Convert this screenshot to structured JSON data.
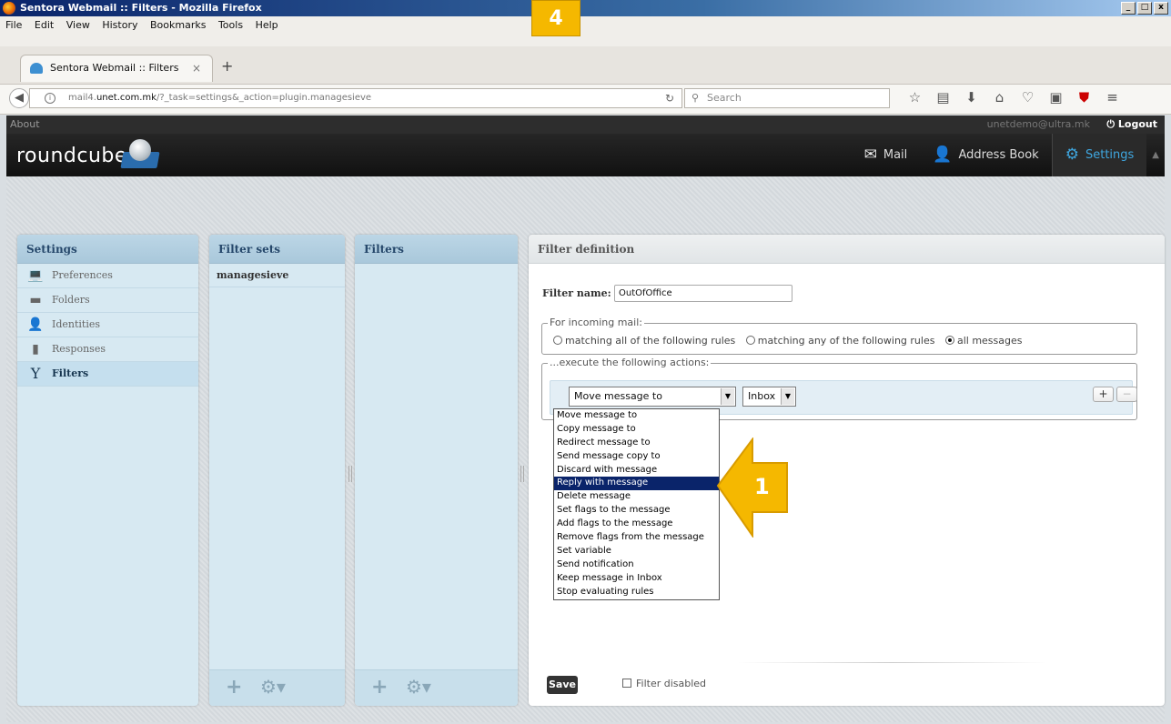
{
  "window": {
    "title": "Sentora Webmail :: Filters - Mozilla Firefox",
    "controls": [
      "_",
      "□",
      "x"
    ]
  },
  "menubar": {
    "items": [
      "File",
      "Edit",
      "View",
      "History",
      "Bookmarks",
      "Tools",
      "Help"
    ]
  },
  "browser": {
    "tab_title": "Sentora Webmail :: Filters",
    "tab_close": "×",
    "new_tab": "+",
    "url_prefix": "mail4.",
    "url_domain": "unet.com.mk",
    "url_path": "/?_task=settings&_action=plugin.managesieve",
    "search_placeholder": "Search",
    "toolbar_icons": [
      "star-icon",
      "reading-list-icon",
      "download-icon",
      "home-icon",
      "pocket-icon",
      "screenshot-icon",
      "ublock-icon",
      "menu-icon"
    ]
  },
  "topline": {
    "about": "About",
    "user": "unetdemo@ultra.mk",
    "logout": "Logout"
  },
  "header": {
    "logo": "roundcube",
    "tasks": [
      {
        "label": "Mail",
        "icon": "envelope-icon"
      },
      {
        "label": "Address Book",
        "icon": "person-icon"
      },
      {
        "label": "Settings",
        "icon": "gear-icon",
        "active": true
      }
    ]
  },
  "settings_panel": {
    "title": "Settings",
    "items": [
      {
        "label": "Preferences",
        "icon": "laptop-icon"
      },
      {
        "label": "Folders",
        "icon": "folder-icon"
      },
      {
        "label": "Identities",
        "icon": "person-icon"
      },
      {
        "label": "Responses",
        "icon": "document-icon"
      },
      {
        "label": "Filters",
        "icon": "filter-icon",
        "selected": true
      }
    ]
  },
  "filtersets_panel": {
    "title": "Filter sets",
    "items": [
      "managesieve"
    ]
  },
  "filters_panel": {
    "title": "Filters"
  },
  "definition": {
    "title": "Filter definition",
    "name_label": "Filter name:",
    "name_value": "OutOfOffice",
    "incoming_legend": "For incoming mail:",
    "match_options": [
      {
        "label": "matching all of the following rules",
        "checked": false
      },
      {
        "label": "matching any of the following rules",
        "checked": false
      },
      {
        "label": "all messages",
        "checked": true
      }
    ],
    "actions_legend": "...execute the following actions:",
    "action_selected": "Move message to",
    "folder_selected": "Inbox",
    "add_label": "+",
    "remove_label": "−",
    "action_options": [
      "Move message to",
      "Copy message to",
      "Redirect message to",
      "Send message copy to",
      "Discard with message",
      "Reply with message",
      "Delete message",
      "Set flags to the message",
      "Add flags to the message",
      "Remove flags from the message",
      "Set variable",
      "Send notification",
      "Keep message in Inbox",
      "Stop evaluating rules"
    ],
    "highlighted_option": "Reply with message",
    "save_label": "Save",
    "disabled_label": "Filter disabled"
  },
  "annotations": {
    "step_top": "4",
    "step_arrow": "1",
    "color": "#f5b800"
  }
}
